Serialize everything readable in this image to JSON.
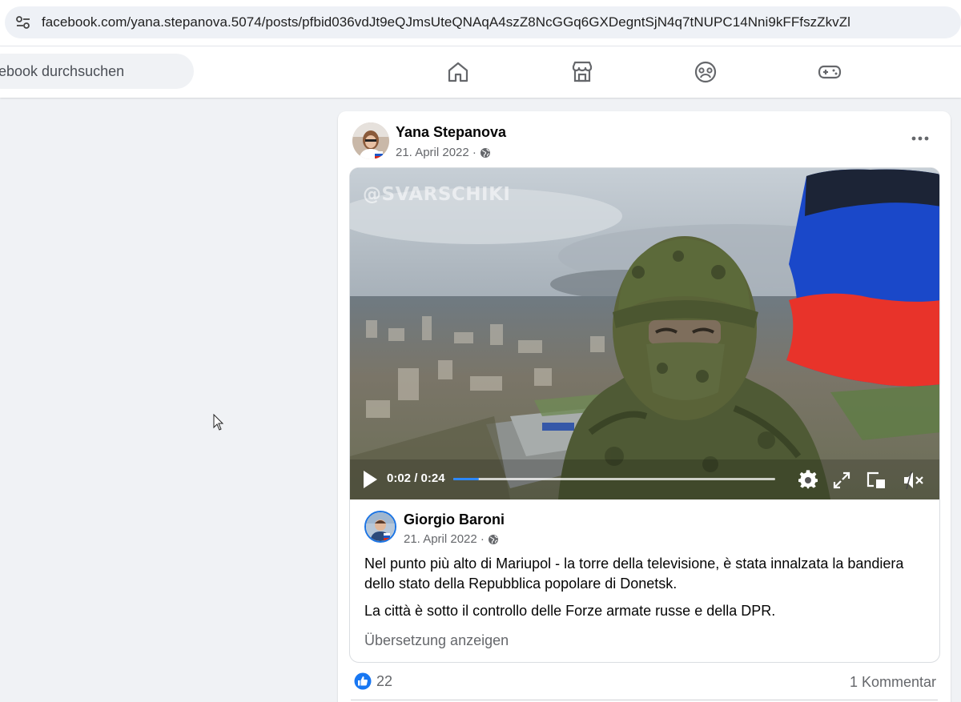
{
  "browser": {
    "url": "facebook.com/yana.stepanova.5074/posts/pfbid036vdJt9eQJmsUteQNAqA4szZ8NcGGq6GXDegntSjN4q7tNUPC14Nni9kFFfszZkvZl"
  },
  "header": {
    "search_placeholder": "ebook durchsuchen",
    "nav": [
      "home-icon",
      "marketplace-icon",
      "groups-icon",
      "gaming-icon"
    ]
  },
  "post": {
    "author": "Yana Stepanova",
    "date": "21. April 2022 ·",
    "privacy_icon": "globe-icon",
    "video": {
      "watermark": "@SVARSCHIKI",
      "time": "0:02 / 0:24",
      "progress": 0.08
    },
    "shared": {
      "author": "Giorgio Baroni",
      "date": "21. April 2022 ·",
      "paragraphs": [
        "Nel punto più alto di Mariupol - la torre della televisione, è stata innalzata la bandiera dello stato della Repubblica popolare di Donetsk.",
        "La città è sotto il controllo delle Forze armate russe e della DPR."
      ],
      "translate_label": "Übersetzung anzeigen"
    },
    "likes": "22",
    "comments": "1 Kommentar"
  },
  "colors": {
    "accent": "#1b74e4",
    "like_blue": "#1877f2",
    "progress": "#2d88ff"
  }
}
